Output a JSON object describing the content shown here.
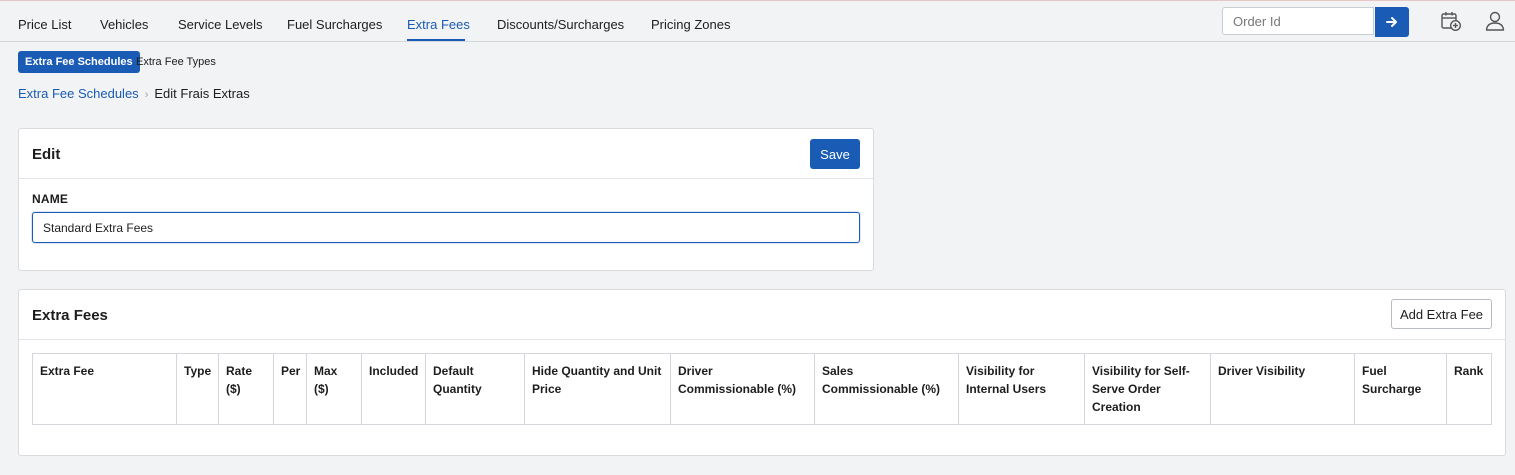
{
  "nav": {
    "tabs": [
      "Price List",
      "Vehicles",
      "Service Levels",
      "Fuel Surcharges",
      "Extra Fees",
      "Discounts/Surcharges",
      "Pricing Zones"
    ],
    "active": "Extra Fees",
    "order_placeholder": "Order Id",
    "icons": [
      "arrow-right-icon",
      "calendar-add-icon",
      "user-icon"
    ]
  },
  "subtabs": [
    "Extra Fee Schedules",
    "Extra Fee Types"
  ],
  "breadcrumb": {
    "parent": "Extra Fee Schedules",
    "current": "Edit Frais Extras"
  },
  "edit_card": {
    "title": "Edit",
    "save_label": "Save",
    "name_label": "NAME",
    "name_value": "Standard Extra Fees"
  },
  "fees_card": {
    "title": "Extra Fees",
    "add_label": "Add Extra Fee",
    "columns": [
      "Extra Fee",
      "Type",
      "Rate ($)",
      "Per",
      "Max ($)",
      "Included",
      "Default Quantity",
      "Hide Quantity and Unit Price",
      "Driver Commissionable (%)",
      "Sales Commissionable (%)",
      "Visibility for Internal Users",
      "Visibility for Self-Serve Order Creation",
      "Driver Visibility",
      "Fuel Surcharge",
      "Rank"
    ]
  },
  "colors": {
    "accent": "#1a5bb5",
    "background": "#f2f3f4"
  }
}
